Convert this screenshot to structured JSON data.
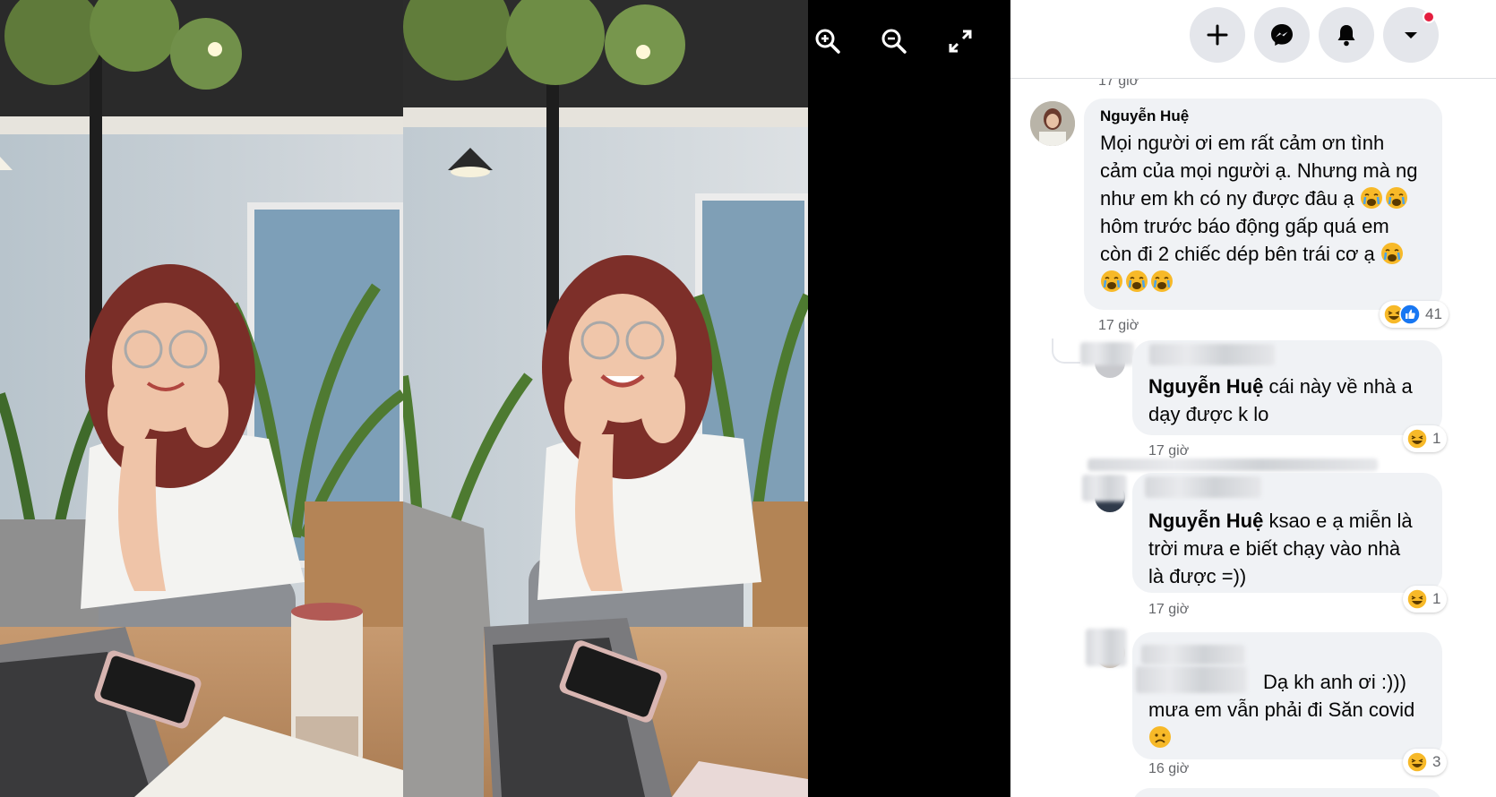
{
  "viewer": {
    "tools": [
      {
        "name": "zoom-in",
        "icon": "zoom-in-icon"
      },
      {
        "name": "zoom-out",
        "icon": "zoom-out-icon"
      },
      {
        "name": "fullscreen",
        "icon": "expand-icon"
      }
    ]
  },
  "topbar": {
    "buttons": [
      {
        "name": "create",
        "icon": "plus-icon"
      },
      {
        "name": "messenger",
        "icon": "messenger-icon"
      },
      {
        "name": "notifications",
        "icon": "bell-icon"
      },
      {
        "name": "account",
        "icon": "caret-down-icon",
        "has_badge": true
      }
    ]
  },
  "comments": {
    "top_partial_time": "17 giờ",
    "main": {
      "author": "Nguyễn Huệ",
      "text": "Mọi người ơi em rất cảm ơn tình\ncảm của mọi người ạ. Nhưng mà ng\nnhư em kh có ny được đâu ạ",
      "text_line4": "hôm trước báo động gấp quá em",
      "text_line5": "còn đi 2 chiếc dép bên trái cơ ạ",
      "time": "17 giờ",
      "reaction_count": "41",
      "reaction_icons": [
        "haha-icon",
        "like-icon"
      ]
    },
    "replies": [
      {
        "mention": "Nguyễn Huệ",
        "text": " cái này về nhà a\ndạy được k lo",
        "time": "17 giờ",
        "reaction_count": "1"
      },
      {
        "mention": "Nguyễn Huệ",
        "text": " ksao e ạ miễn là\ntrời mưa e biết chạy vào nhà\nlà được =))",
        "time": "17 giờ",
        "reaction_count": "1"
      },
      {
        "text_line1": "Dạ kh anh ơi :)))",
        "text_line2": "mưa em vẫn phải đi Săn covid",
        "time": "16 giờ",
        "reaction_count": "3"
      }
    ]
  },
  "colors": {
    "bubble": "#f0f2f5",
    "secondary_text": "#65676b",
    "like_blue": "#1877f2",
    "haha_yellow": "#f7b928",
    "badge_red": "#e41e3f"
  }
}
